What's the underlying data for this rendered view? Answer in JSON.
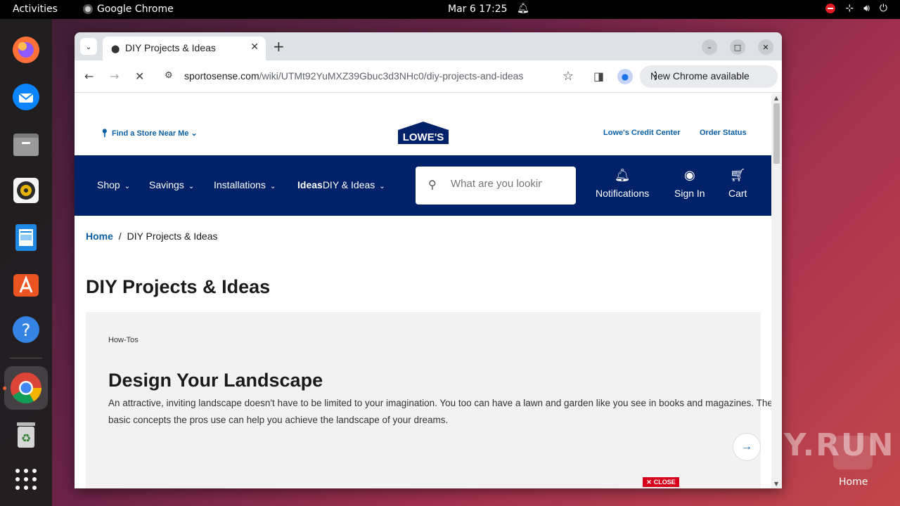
{
  "topbar": {
    "activities": "Activities",
    "app_name": "Google Chrome",
    "clock": "Mar 6  17:25"
  },
  "browser": {
    "tab_title": "DIY Projects & Ideas",
    "url_host": "sportosense.com",
    "url_path": "/wiki/UTMt92YuMXZ39Gbuc3d3NHc0/diy-projects-and-ideas",
    "new_chrome": "New Chrome available"
  },
  "site": {
    "store_link": "Find a Store Near Me",
    "logo_text": "LOWE'S",
    "credit_center": "Lowe's Credit Center",
    "order_status": "Order Status",
    "nav": {
      "shop": "Shop",
      "savings": "Savings",
      "installations": "Installations",
      "ideas_bold": "Ideas",
      "ideas": "DIY & Ideas"
    },
    "search_placeholder": "What are you looking for today?",
    "notifications": "Notifications",
    "sign_in": "Sign In",
    "cart": "Cart"
  },
  "breadcrumb": {
    "home": "Home",
    "sep": "/",
    "current": "DIY Projects & Ideas"
  },
  "page_title": "DIY Projects & Ideas",
  "card": {
    "kicker": "How-Tos",
    "title": "Design Your Landscape",
    "description": "An attractive, inviting landscape doesn't have to be limited to your imagination. You too can have a lawn and garden like you see in books and magazines. The basic concepts the pros use can help you achieve the landscape of your dreams."
  },
  "ad_close": "CLOSE",
  "desktop": {
    "home_label": "Home",
    "watermark": "ANY.RUN"
  }
}
